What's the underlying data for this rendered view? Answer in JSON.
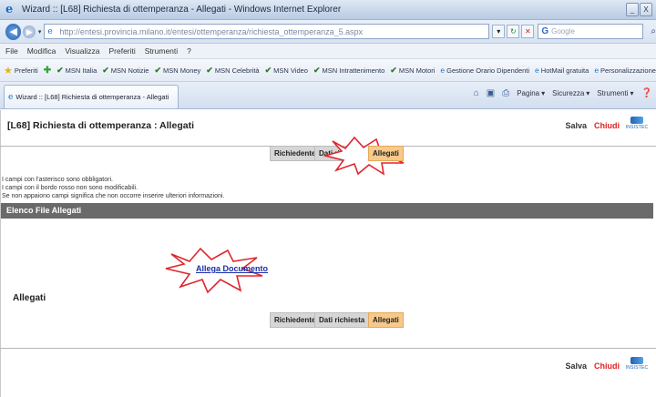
{
  "window": {
    "title": "Wizard :: [L68] Richiesta di ottemperanza - Allegati - Windows Internet Explorer",
    "minimize_glyph": "_",
    "close_glyph": "X"
  },
  "address": {
    "url": "http://entesi.provincia.milano.it/entesi/ottemperanza/richiesta_ottemperanza_5.aspx",
    "search_placeholder": "Google"
  },
  "menu": [
    "File",
    "Modifica",
    "Visualizza",
    "Preferiti",
    "Strumenti",
    "?"
  ],
  "favorites": {
    "label": "Preferiti",
    "items": [
      {
        "label": "MSN Italia",
        "icon": "msn-icon"
      },
      {
        "label": "MSN Notizie",
        "icon": "msn-icon"
      },
      {
        "label": "MSN Money",
        "icon": "msn-icon"
      },
      {
        "label": "MSN Celebrità",
        "icon": "msn-icon"
      },
      {
        "label": "MSN Video",
        "icon": "msn-icon"
      },
      {
        "label": "MSN Intrattenimento",
        "icon": "msn-icon"
      },
      {
        "label": "MSN Motori",
        "icon": "msn-icon"
      },
      {
        "label": "Gestione Orario Dipendenti",
        "icon": "ie-page-icon"
      },
      {
        "label": "HotMail gratuita",
        "icon": "ie-page-icon"
      },
      {
        "label": "Personalizzazione collegamenti",
        "icon": "ie-page-icon"
      }
    ]
  },
  "tab": {
    "title": "Wizard :: [L68] Richiesta di ottemperanza - Allegati"
  },
  "commands": {
    "page": "Pagina",
    "security": "Sicurezza",
    "tools": "Strumenti"
  },
  "page": {
    "title": "[L68] Richiesta di ottemperanza : Allegati",
    "save": "Salva",
    "close": "Chiudi",
    "logo_text": "INSISTEC",
    "steps": [
      "Richiedente",
      "Dati richiesta",
      "Allegati"
    ],
    "active_step": "Allegati",
    "notes": [
      "I campi con l'asterisco sono obbligatori.",
      "I campi con il bordo rosso non sono modificabili.",
      "Se non appaiono campi significa che non occorre inserire ulteriori informazioni."
    ],
    "section_title": "Elenco File Allegati",
    "attach_link": "Allega Documento",
    "attachments_label": "Allegati"
  },
  "colors": {
    "active_step": "#f7c98b",
    "inactive_step": "#d6d6d6",
    "section_bar": "#6a6a6a",
    "burst_stroke": "#e0262e",
    "close_red": "#d22222",
    "link_blue": "#1a2ea8"
  }
}
